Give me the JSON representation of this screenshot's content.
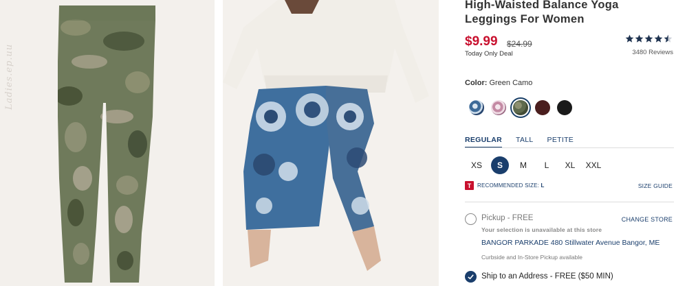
{
  "watermark": "Ladies.ep.uu",
  "product": {
    "title": "High-Waisted Balance Yoga Leggings For Women",
    "price": "$9.99",
    "original_price": "$24.99",
    "deal_text": "Today Only Deal",
    "rating": 4.5,
    "review_count": "3480 Reviews"
  },
  "color": {
    "label": "Color:",
    "selected": "Green Camo",
    "swatches": [
      {
        "name": "blue-tie-dye",
        "color": "#5b7fa6"
      },
      {
        "name": "pink-tie-dye",
        "color": "#d8aebf"
      },
      {
        "name": "green-camo",
        "color": "#5f6a4d",
        "selected": true
      },
      {
        "name": "burgundy",
        "color": "#4a1e1e"
      },
      {
        "name": "black",
        "color": "#1a1a1a"
      }
    ]
  },
  "fits": [
    "REGULAR",
    "TALL",
    "PETITE"
  ],
  "active_fit": "REGULAR",
  "sizes": [
    "XS",
    "S",
    "M",
    "L",
    "XL",
    "XXL"
  ],
  "selected_size": "S",
  "recommended": {
    "icon_letter": "T",
    "label": "RECOMMENDED SIZE:",
    "size": "L"
  },
  "size_guide": "SIZE GUIDE",
  "pickup": {
    "label": "Pickup - FREE",
    "change_store": "CHANGE STORE",
    "unavailable": "Your selection is unavailable at this store",
    "store": "BANGOR PARKADE 480 Stillwater Avenue  Bangor, ME",
    "curbside": "Curbside and In-Store Pickup available"
  },
  "ship": {
    "label": "Ship to an Address - FREE ($50 MIN)"
  },
  "colors": {
    "accent_navy": "#1a3e6c",
    "price_red": "#c8102e"
  }
}
